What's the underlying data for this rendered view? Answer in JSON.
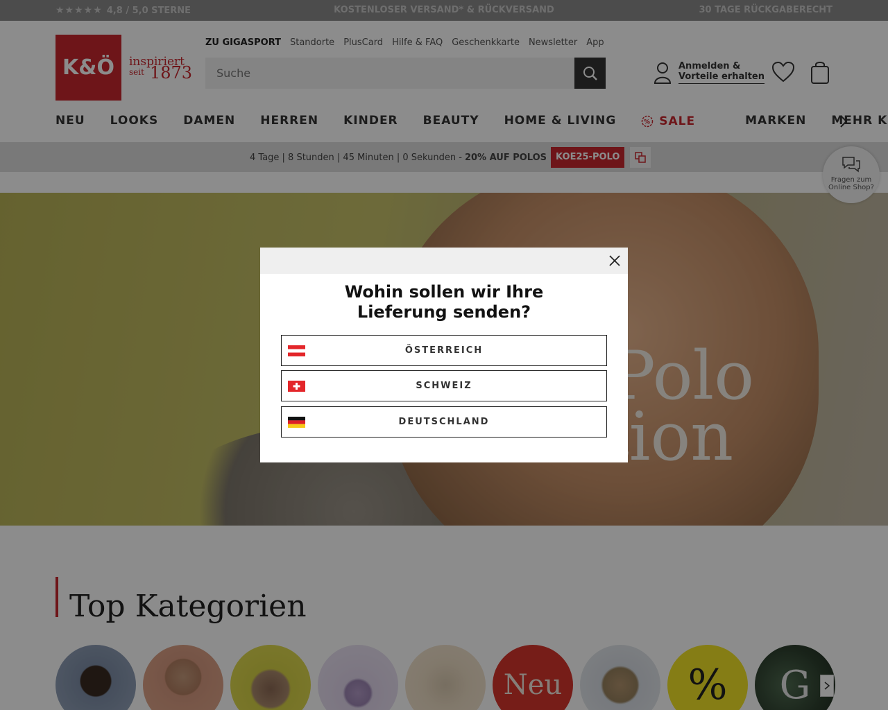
{
  "topbar": {
    "rating": "4,8 / 5,0 STERNE",
    "shipping": "KOSTENLOSER VERSAND* & RÜCKVERSAND",
    "returns": "30 TAGE RÜCKGABERECHT"
  },
  "brand": {
    "logo_text": "K&Ö",
    "tagline_top": "inspiriert",
    "tagline_since": "seit",
    "tagline_year": "1873"
  },
  "toplinks": [
    "ZU GIGASPORT",
    "Standorte",
    "PlusCard",
    "Hilfe & FAQ",
    "Geschenkkarte",
    "Newsletter",
    "App"
  ],
  "search": {
    "placeholder": "Suche"
  },
  "account": {
    "line1": "Anmelden &",
    "line2": "Vorteile erhalten"
  },
  "nav": {
    "items": [
      "NEU",
      "LOOKS",
      "DAMEN",
      "HERREN",
      "KINDER",
      "BEAUTY",
      "HOME & LIVING",
      "SALE",
      "MARKEN",
      "MEHR K"
    ]
  },
  "promo": {
    "countdown": "4 Tage | 8 Stunden | 45 Minuten | 0 Sekunden -",
    "offer": "20% AUF POLOS",
    "code": "KOE25-POLO"
  },
  "chat": {
    "line1": "Fragen zum",
    "line2": "Online Shop?"
  },
  "hero": {
    "line1": "Polo",
    "line2": "ktion"
  },
  "categories": {
    "title": "Top Kategorien",
    "neu_label": "Neu",
    "percent_label": "%",
    "g_label": "G"
  },
  "modal": {
    "title": "Wohin sollen wir Ihre Lieferung senden?",
    "options": [
      "ÖSTERREICH",
      "SCHWEIZ",
      "DEUTSCHLAND"
    ]
  },
  "colors": {
    "brand_red": "#c8272e",
    "overlay": "rgba(0,0,0,0.45)"
  }
}
